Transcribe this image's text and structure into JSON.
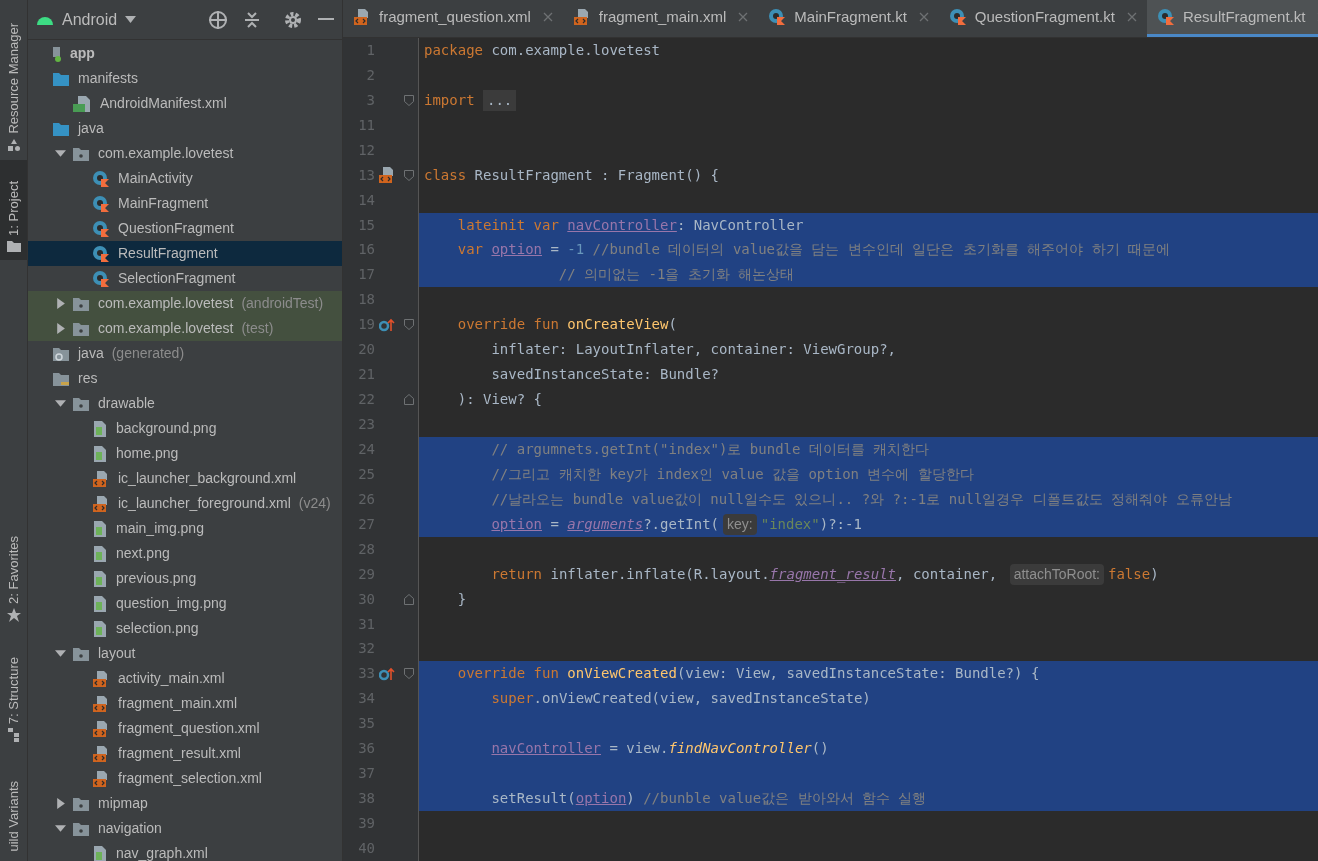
{
  "tool_strip": [
    {
      "label": "Resource Manager",
      "kind": "resource",
      "selected": false
    },
    {
      "label": "1: Project",
      "kind": "project",
      "selected": true
    },
    {
      "label": "2: Favorites",
      "kind": "favorites",
      "selected": false
    },
    {
      "label": "7: Structure",
      "kind": "structure",
      "selected": false
    },
    {
      "label": "uild Variants",
      "kind": "variants",
      "selected": false
    }
  ],
  "project": {
    "view": "Android",
    "tree": [
      {
        "label": "app",
        "kind": "app",
        "selected": false
      },
      {
        "label": "manifests",
        "kind": "folder",
        "selected": false,
        "children": [
          {
            "label": "AndroidManifest.xml",
            "kind": "manifest",
            "selected": false
          }
        ]
      },
      {
        "label": "java",
        "kind": "folder",
        "selected": false,
        "children": [
          {
            "label": "com.example.lovetest",
            "kind": "package",
            "expanded": true,
            "selected": false,
            "children": [
              {
                "label": "MainActivity",
                "kind": "kotlin",
                "selected": false
              },
              {
                "label": "MainFragment",
                "kind": "kotlin",
                "selected": false
              },
              {
                "label": "QuestionFragment",
                "kind": "kotlin",
                "selected": false
              },
              {
                "label": "ResultFragment",
                "kind": "kotlin",
                "selected": true
              },
              {
                "label": "SelectionFragment",
                "kind": "kotlin",
                "selected": false
              }
            ]
          },
          {
            "label": "com.example.lovetest",
            "suffix": "(androidTest)",
            "kind": "test-package",
            "expanded": false,
            "selected": false
          },
          {
            "label": "com.example.lovetest",
            "suffix": "(test)",
            "kind": "test-package",
            "expanded": false,
            "selected": false
          }
        ]
      },
      {
        "label": "java",
        "suffix": "(generated)",
        "kind": "gen-folder",
        "selected": false
      },
      {
        "label": "res",
        "kind": "res-folder",
        "selected": false,
        "children": [
          {
            "label": "drawable",
            "kind": "package",
            "expanded": true,
            "selected": false,
            "children": [
              {
                "label": "background.png",
                "kind": "png",
                "selected": false
              },
              {
                "label": "home.png",
                "kind": "png",
                "selected": false
              },
              {
                "label": "ic_launcher_background.xml",
                "kind": "xml",
                "selected": false
              },
              {
                "label": "ic_launcher_foreground.xml",
                "suffix": "(v24)",
                "kind": "xml",
                "selected": false
              },
              {
                "label": "main_img.png",
                "kind": "png",
                "selected": false
              },
              {
                "label": "next.png",
                "kind": "png",
                "selected": false
              },
              {
                "label": "previous.png",
                "kind": "png",
                "selected": false
              },
              {
                "label": "question_img.png",
                "kind": "png",
                "selected": false
              },
              {
                "label": "selection.png",
                "kind": "png",
                "selected": false
              }
            ]
          },
          {
            "label": "layout",
            "kind": "package",
            "expanded": true,
            "selected": false,
            "children": [
              {
                "label": "activity_main.xml",
                "kind": "xml",
                "selected": false
              },
              {
                "label": "fragment_main.xml",
                "kind": "xml",
                "selected": false
              },
              {
                "label": "fragment_question.xml",
                "kind": "xml",
                "selected": false
              },
              {
                "label": "fragment_result.xml",
                "kind": "xml",
                "selected": false
              },
              {
                "label": "fragment_selection.xml",
                "kind": "xml",
                "selected": false
              }
            ]
          },
          {
            "label": "mipmap",
            "kind": "package",
            "expanded": false,
            "selected": false
          },
          {
            "label": "navigation",
            "kind": "package",
            "expanded": true,
            "selected": false,
            "children": [
              {
                "label": "nav_graph.xml",
                "kind": "png",
                "selected": false
              }
            ]
          }
        ]
      }
    ]
  },
  "editor": {
    "tabs": [
      {
        "label": "fragment_question.xml",
        "kind": "xml",
        "selected": false
      },
      {
        "label": "fragment_main.xml",
        "kind": "xml",
        "selected": false
      },
      {
        "label": "MainFragment.kt",
        "kind": "kotlin",
        "selected": false
      },
      {
        "label": "QuestionFragment.kt",
        "kind": "kotlin",
        "selected": false
      },
      {
        "label": "ResultFragment.kt",
        "kind": "kotlin",
        "selected": true
      }
    ],
    "lines": [
      {
        "n": "1",
        "selected": false,
        "tokens": [
          {
            "kind": "keyword",
            "text": "package "
          },
          {
            "kind": "plain",
            "text": "com.example.lovetest"
          }
        ]
      },
      {
        "n": "2",
        "selected": false
      },
      {
        "n": "3",
        "selected": false,
        "markers": [
          {
            "kind": "fold-start"
          }
        ],
        "tokens": [
          {
            "kind": "keyword",
            "text": "import "
          },
          {
            "kind": "folded",
            "text": "..."
          }
        ]
      },
      {
        "n": "11",
        "selected": false
      },
      {
        "n": "12",
        "selected": false
      },
      {
        "n": "13",
        "selected": false,
        "markers": [
          {
            "kind": "layout-link"
          },
          {
            "kind": "fold-start"
          }
        ],
        "tokens": [
          {
            "kind": "keyword",
            "text": "class "
          },
          {
            "kind": "plain",
            "text": "ResultFragment : Fragment() {"
          }
        ]
      },
      {
        "n": "14",
        "selected": false
      },
      {
        "n": "15",
        "selected": true,
        "tokens": [
          {
            "kind": "keyword",
            "text": "    lateinit var "
          },
          {
            "kind": "property",
            "text": "navController"
          },
          {
            "kind": "plain",
            "text": ": NavController"
          }
        ]
      },
      {
        "n": "16",
        "selected": true,
        "tokens": [
          {
            "kind": "keyword",
            "text": "    var "
          },
          {
            "kind": "property",
            "text": "option"
          },
          {
            "kind": "plain",
            "text": " = "
          },
          {
            "kind": "number",
            "text": "-1"
          },
          {
            "kind": "comment",
            "text": " //bundle 데이터의 value값을 담는 변수인데 일단은 초기화를 해주어야 하기 때문에"
          }
        ]
      },
      {
        "n": "17",
        "selected": true,
        "tokens": [
          {
            "kind": "comment",
            "text": "                // 의미없는 -1을 초기화 해논상태"
          }
        ]
      },
      {
        "n": "18",
        "selected": false
      },
      {
        "n": "19",
        "selected": false,
        "markers": [
          {
            "kind": "override"
          },
          {
            "kind": "fold-start"
          }
        ],
        "tokens": [
          {
            "kind": "keyword",
            "text": "    override fun "
          },
          {
            "kind": "function",
            "text": "onCreateView"
          },
          {
            "kind": "plain",
            "text": "("
          }
        ]
      },
      {
        "n": "20",
        "selected": false,
        "tokens": [
          {
            "kind": "plain",
            "text": "        inflater: LayoutInflater, container: ViewGroup?,"
          }
        ]
      },
      {
        "n": "21",
        "selected": false,
        "tokens": [
          {
            "kind": "plain",
            "text": "        savedInstanceState: Bundle?"
          }
        ]
      },
      {
        "n": "22",
        "selected": false,
        "markers": [
          {
            "kind": "fold-end"
          }
        ],
        "tokens": [
          {
            "kind": "plain",
            "text": "    ): View? {"
          }
        ]
      },
      {
        "n": "23",
        "selected": false
      },
      {
        "n": "24",
        "selected": true,
        "tokens": [
          {
            "kind": "comment",
            "text": "        // argumnets.getInt(\"index\")로 bundle 데이터를 캐치한다"
          }
        ]
      },
      {
        "n": "25",
        "selected": true,
        "tokens": [
          {
            "kind": "comment",
            "text": "        //그리고 캐치한 key가 index인 value 값을 option 변수에 할당한다"
          }
        ]
      },
      {
        "n": "26",
        "selected": true,
        "tokens": [
          {
            "kind": "comment",
            "text": "        //날라오는 bundle value값이 null일수도 있으니.. ?와 ?:-1로 null일경우 디폴트값도 정해줘야 오류안남"
          }
        ]
      },
      {
        "n": "27",
        "selected": true,
        "tokens": [
          {
            "kind": "property",
            "text": "        option"
          },
          {
            "kind": "plain",
            "text": " = "
          },
          {
            "kind": "property-italic",
            "text": "arguments"
          },
          {
            "kind": "plain",
            "text": "?.getInt("
          },
          {
            "kind": "hint",
            "text": "key:"
          },
          {
            "kind": "string",
            "text": "\"index\""
          },
          {
            "kind": "plain",
            "text": ")?:-1"
          }
        ]
      },
      {
        "n": "28",
        "selected": false
      },
      {
        "n": "29",
        "selected": false,
        "tokens": [
          {
            "kind": "keyword",
            "text": "        return "
          },
          {
            "kind": "plain",
            "text": "inflater.inflate(R.layout."
          },
          {
            "kind": "property-italic",
            "text": "fragment_result"
          },
          {
            "kind": "plain",
            "text": ", container, "
          },
          {
            "kind": "hint",
            "text": "attachToRoot:"
          },
          {
            "kind": "keyword",
            "text": "false"
          },
          {
            "kind": "plain",
            "text": ")"
          }
        ]
      },
      {
        "n": "30",
        "selected": false,
        "markers": [
          {
            "kind": "fold-end"
          }
        ],
        "tokens": [
          {
            "kind": "plain",
            "text": "    }"
          }
        ]
      },
      {
        "n": "31",
        "selected": false
      },
      {
        "n": "32",
        "selected": false
      },
      {
        "n": "33",
        "selected": true,
        "markers": [
          {
            "kind": "override"
          },
          {
            "kind": "fold-start"
          }
        ],
        "tokens": [
          {
            "kind": "keyword",
            "text": "    override fun "
          },
          {
            "kind": "function",
            "text": "onViewCreated"
          },
          {
            "kind": "plain",
            "text": "(view: View, savedInstanceState: Bundle?) {"
          }
        ]
      },
      {
        "n": "34",
        "selected": true,
        "tokens": [
          {
            "kind": "keyword",
            "text": "        super"
          },
          {
            "kind": "plain",
            "text": ".onViewCreated(view, savedInstanceState)"
          }
        ]
      },
      {
        "n": "35",
        "selected": true
      },
      {
        "n": "36",
        "selected": true,
        "tokens": [
          {
            "kind": "property",
            "text": "        navController"
          },
          {
            "kind": "plain",
            "text": " = view."
          },
          {
            "kind": "function-italic",
            "text": "findNavController"
          },
          {
            "kind": "plain",
            "text": "()"
          }
        ]
      },
      {
        "n": "37",
        "selected": true
      },
      {
        "n": "38",
        "selected": true,
        "tokens": [
          {
            "kind": "plain",
            "text": "        setResult("
          },
          {
            "kind": "property",
            "text": "option"
          },
          {
            "kind": "plain",
            "text": ") "
          },
          {
            "kind": "comment",
            "text": "//bunble value값은 받아와서 함수 실행"
          }
        ]
      },
      {
        "n": "39",
        "selected": false
      },
      {
        "n": "40",
        "selected": false
      }
    ]
  }
}
